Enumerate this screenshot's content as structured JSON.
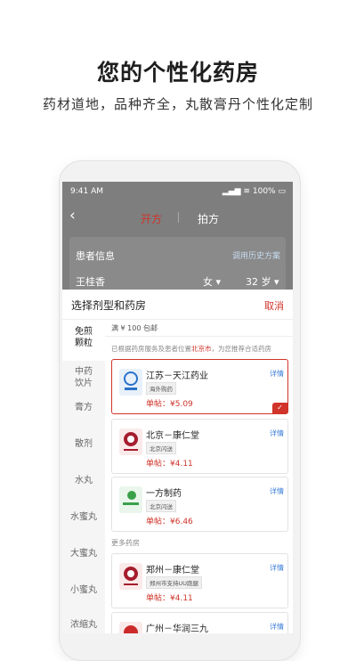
{
  "promo": {
    "headline": "您的个性化药房",
    "subline": "药材道地，品种齐全，丸散膏丹个性化定制"
  },
  "statusbar": {
    "time": "9:41 AM",
    "battery": "100%"
  },
  "nav": {
    "back_icon": "chevron-left",
    "tab_active": "开方",
    "tab_other": "拍方"
  },
  "patient": {
    "title": "患者信息",
    "history_link": "调用历史方案",
    "name": "王桂香",
    "sex": "女",
    "age": "32",
    "age_unit": "岁"
  },
  "sheet": {
    "title": "选择剂型和药房",
    "cancel": "取消",
    "forms": [
      {
        "label": "免煎\n颗粒",
        "active": true
      },
      {
        "label": "中药\n饮片"
      },
      {
        "label": "膏方"
      },
      {
        "label": "散剂"
      },
      {
        "label": "水丸"
      },
      {
        "label": "水蜜丸"
      },
      {
        "label": "大蜜丸"
      },
      {
        "label": "小蜜丸"
      },
      {
        "label": "浓缩丸"
      }
    ],
    "free_shipping": "满 ¥ 100 包邮",
    "recommend_prefix": "已根据药房服务及患者位置",
    "recommend_city": "北京市",
    "recommend_suffix": "，为您推荐合适药房",
    "more_label": "更多药房",
    "detail_label": "详情",
    "pharmacies": [
      {
        "name": "江苏－天江药业",
        "tag": "海外购药",
        "price": "单帖：¥5.09",
        "selected": true,
        "logo_color": "#2a73c9"
      },
      {
        "name": "北京－康仁堂",
        "tag": "北京闪送",
        "price": "单帖：¥4.11",
        "logo_color": "#a51d2d"
      },
      {
        "name": "一方制药",
        "tag": "北京闪送",
        "price": "单帖：¥6.46",
        "logo_color": "#3aa14a"
      },
      {
        "name": "郑州－康仁堂",
        "tag": "郑州市支持UU跑腿",
        "price": "单帖：¥4.11",
        "logo_color": "#a51d2d"
      },
      {
        "name": "广州－华润三九",
        "tag": "",
        "price": "",
        "logo_color": "#cc2a2a"
      }
    ]
  }
}
